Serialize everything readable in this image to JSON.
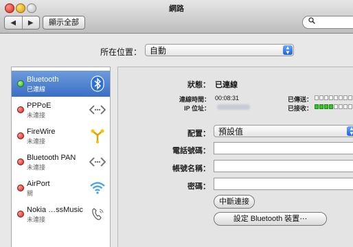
{
  "window": {
    "title": "網路"
  },
  "toolbar": {
    "back_icon": "◀",
    "forward_icon": "▶",
    "show_all_label": "顯示全部",
    "search_icon": "🔍"
  },
  "location": {
    "label": "所在位置：",
    "value": "自動"
  },
  "services": [
    {
      "name": "Bluetooth",
      "status": "已連線",
      "status_color": "green",
      "icon": "bluetooth-icon"
    },
    {
      "name": "PPPoE",
      "status": "未連接",
      "status_color": "red",
      "icon": "ethernet-arrows-icon"
    },
    {
      "name": "FireWire",
      "status": "未連接",
      "status_color": "red",
      "icon": "firewire-icon"
    },
    {
      "name": "Bluetooth PAN",
      "status": "未連接",
      "status_color": "red",
      "icon": "ethernet-arrows-icon"
    },
    {
      "name": "AirPort",
      "status": "關",
      "status_color": "red",
      "icon": "wifi-icon"
    },
    {
      "name": "Nokia …ssMusic",
      "status": "未連接",
      "status_color": "red",
      "icon": "phone-icon"
    }
  ],
  "detail": {
    "status_label": "狀態：",
    "status_value": "已連線",
    "conn_time_label": "連線時間：",
    "conn_time_value": "00:08:31",
    "ip_label": "IP 位址：",
    "sent_label": "已傳送：",
    "recv_label": "已接收：",
    "config_label": "配置：",
    "config_value": "預設值",
    "phone_label": "電話號碼：",
    "account_label": "帳號名稱：",
    "password_label": "密碼：",
    "disconnect_label": "中斷連接",
    "bt_settings_label": "設定 Bluetooth 裝置⋯"
  },
  "meters": {
    "sent_level": 0,
    "recv_level": 0.5
  },
  "colors": {
    "selection": "#3a6fc6",
    "connected": "#27a81c",
    "disconnected": "#d2211a"
  }
}
